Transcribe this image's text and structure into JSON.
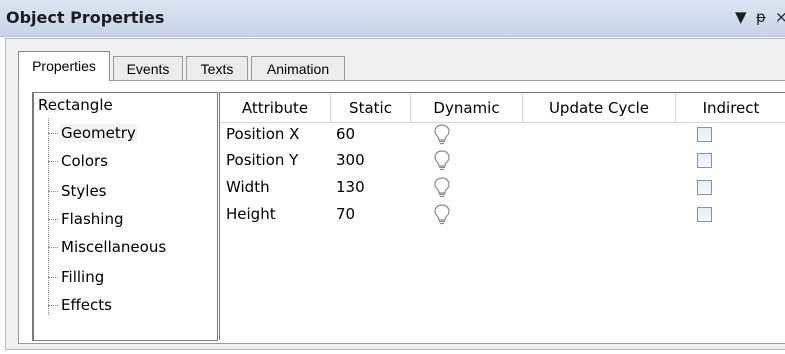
{
  "window": {
    "title": "Object Properties",
    "controls": [
      "▼",
      "ᵽ",
      "×"
    ]
  },
  "tabs": [
    {
      "label": "Properties",
      "active": true
    },
    {
      "label": "Events",
      "active": false
    },
    {
      "label": "Texts",
      "active": false
    },
    {
      "label": "Animation",
      "active": false
    }
  ],
  "tree": {
    "root": "Rectangle",
    "items": [
      "Geometry",
      "Colors",
      "Styles",
      "Flashing",
      "Miscellaneous",
      "Filling",
      "Effects"
    ],
    "selected": "Geometry"
  },
  "table": {
    "columns": [
      "Attribute",
      "Static",
      "Dynamic",
      "Update Cycle",
      "Indirect"
    ],
    "rows": [
      {
        "attribute": "Position X",
        "static": "60",
        "dynamic_icon": "lightbulb-icon",
        "update_cycle": "",
        "indirect": false
      },
      {
        "attribute": "Position Y",
        "static": "300",
        "dynamic_icon": "lightbulb-icon",
        "update_cycle": "",
        "indirect": false
      },
      {
        "attribute": "Width",
        "static": "130",
        "dynamic_icon": "lightbulb-icon",
        "update_cycle": "",
        "indirect": false
      },
      {
        "attribute": "Height",
        "static": "70",
        "dynamic_icon": "lightbulb-icon",
        "update_cycle": "",
        "indirect": false
      }
    ]
  },
  "colors": {
    "titlebar": "#d3ddec",
    "panel": "#f0f0f0",
    "checkbox_border": "#7e95b5"
  }
}
